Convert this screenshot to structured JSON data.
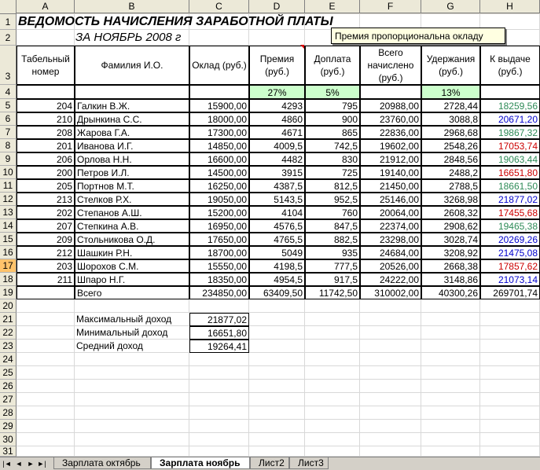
{
  "columns": [
    "A",
    "B",
    "C",
    "D",
    "E",
    "F",
    "G",
    "H"
  ],
  "comment": "Премия пропорциональна окладу",
  "title": "ВЕДОМОСТЬ НАЧИСЛЕНИЯ ЗАРАБОТНОЙ ПЛАТЫ",
  "subtitle": "ЗА НОЯБРЬ 2008 г",
  "headers": {
    "a": "Табельный номер",
    "b": "Фамилия И.О.",
    "c": "Оклад (руб.)",
    "d": "Премия (руб.)",
    "e": "Доплата (руб.)",
    "f": "Всего начислено (руб.)",
    "g": "Удержания (руб.)",
    "h": "К выдаче (руб.)"
  },
  "rates": {
    "d": "27%",
    "e": "5%",
    "g": "13%"
  },
  "rows": [
    {
      "num": "5",
      "id": "204",
      "name": "Галкин В.Ж.",
      "salary": "15900,00",
      "bonus": "4293",
      "extra": "795",
      "total": "20988,00",
      "ded": "2728,44",
      "pay": "18259,56",
      "color": "#2e8b57"
    },
    {
      "num": "6",
      "id": "210",
      "name": "Дрынкина С.С.",
      "salary": "18000,00",
      "bonus": "4860",
      "extra": "900",
      "total": "23760,00",
      "ded": "3088,8",
      "pay": "20671,20",
      "color": "#0000cc"
    },
    {
      "num": "7",
      "id": "208",
      "name": "Жарова Г.А.",
      "salary": "17300,00",
      "bonus": "4671",
      "extra": "865",
      "total": "22836,00",
      "ded": "2968,68",
      "pay": "19867,32",
      "color": "#2e8b57"
    },
    {
      "num": "8",
      "id": "201",
      "name": "Иванова И.Г.",
      "salary": "14850,00",
      "bonus": "4009,5",
      "extra": "742,5",
      "total": "19602,00",
      "ded": "2548,26",
      "pay": "17053,74",
      "color": "#cc0000"
    },
    {
      "num": "9",
      "id": "206",
      "name": "Орлова Н.Н.",
      "salary": "16600,00",
      "bonus": "4482",
      "extra": "830",
      "total": "21912,00",
      "ded": "2848,56",
      "pay": "19063,44",
      "color": "#2e8b57"
    },
    {
      "num": "10",
      "id": "200",
      "name": "Петров И.Л.",
      "salary": "14500,00",
      "bonus": "3915",
      "extra": "725",
      "total": "19140,00",
      "ded": "2488,2",
      "pay": "16651,80",
      "color": "#cc0000"
    },
    {
      "num": "11",
      "id": "205",
      "name": "Портнов М.Т.",
      "salary": "16250,00",
      "bonus": "4387,5",
      "extra": "812,5",
      "total": "21450,00",
      "ded": "2788,5",
      "pay": "18661,50",
      "color": "#2e8b57"
    },
    {
      "num": "12",
      "id": "213",
      "name": "Стелков Р.Х.",
      "salary": "19050,00",
      "bonus": "5143,5",
      "extra": "952,5",
      "total": "25146,00",
      "ded": "3268,98",
      "pay": "21877,02",
      "color": "#0000cc"
    },
    {
      "num": "13",
      "id": "202",
      "name": "Степанов А.Ш.",
      "salary": "15200,00",
      "bonus": "4104",
      "extra": "760",
      "total": "20064,00",
      "ded": "2608,32",
      "pay": "17455,68",
      "color": "#cc0000"
    },
    {
      "num": "14",
      "id": "207",
      "name": "Степкина А.В.",
      "salary": "16950,00",
      "bonus": "4576,5",
      "extra": "847,5",
      "total": "22374,00",
      "ded": "2908,62",
      "pay": "19465,38",
      "color": "#2e8b57"
    },
    {
      "num": "15",
      "id": "209",
      "name": "Стольникова О.Д.",
      "salary": "17650,00",
      "bonus": "4765,5",
      "extra": "882,5",
      "total": "23298,00",
      "ded": "3028,74",
      "pay": "20269,26",
      "color": "#0000cc"
    },
    {
      "num": "16",
      "id": "212",
      "name": "Шашкин Р.Н.",
      "salary": "18700,00",
      "bonus": "5049",
      "extra": "935",
      "total": "24684,00",
      "ded": "3208,92",
      "pay": "21475,08",
      "color": "#0000cc"
    },
    {
      "num": "17",
      "id": "203",
      "name": "Шорохов С.М.",
      "salary": "15550,00",
      "bonus": "4198,5",
      "extra": "777,5",
      "total": "20526,00",
      "ded": "2668,38",
      "pay": "17857,62",
      "color": "#cc0000"
    },
    {
      "num": "18",
      "id": "211",
      "name": "Шпаро Н.Г.",
      "salary": "18350,00",
      "bonus": "4954,5",
      "extra": "917,5",
      "total": "24222,00",
      "ded": "3148,86",
      "pay": "21073,14",
      "color": "#0000cc"
    }
  ],
  "totals": {
    "label": "Всего",
    "salary": "234850,00",
    "bonus": "63409,50",
    "extra": "11742,50",
    "total": "310002,00",
    "ded": "40300,26",
    "pay": "269701,74"
  },
  "stats": [
    {
      "label": "Максимальный доход",
      "value": "21877,02"
    },
    {
      "label": "Минимальный доход",
      "value": "16651,80"
    },
    {
      "label": "Средний доход",
      "value": "19264,41"
    }
  ],
  "row_numbers": [
    "1",
    "2",
    "3",
    "4",
    "5",
    "6",
    "7",
    "8",
    "9",
    "10",
    "11",
    "12",
    "13",
    "14",
    "15",
    "16",
    "17",
    "18",
    "19",
    "20",
    "21",
    "22",
    "23",
    "24",
    "25",
    "26",
    "27",
    "28",
    "29",
    "30",
    "31"
  ],
  "selected_row": "17",
  "tabs": [
    "Зарплата октябрь",
    "Зарплата ноябрь",
    "Лист2",
    "Лист3"
  ],
  "active_tab": "Зарплата ноябрь",
  "nav_icons": [
    "first-sheet-icon",
    "prev-sheet-icon",
    "next-sheet-icon",
    "last-sheet-icon"
  ]
}
